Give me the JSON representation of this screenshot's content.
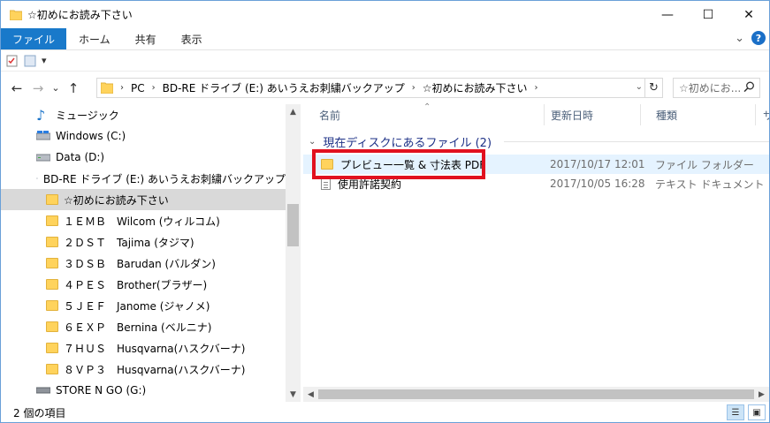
{
  "window": {
    "title": "☆初めにお読み下さい",
    "minimize": "—",
    "maximize": "☐",
    "close": "✕"
  },
  "ribbon": {
    "tabs": [
      "ファイル",
      "ホーム",
      "共有",
      "表示"
    ],
    "expand": "⌄",
    "help": "?"
  },
  "quick_access": {
    "dropdown": "▾"
  },
  "address": {
    "back": "←",
    "forward": "→",
    "recent": "⌄",
    "up": "↑",
    "segments": [
      "PC",
      "BD-RE ドライブ (E:) あいうえお刺繍バックアップ",
      "☆初めにお読み下さい"
    ],
    "separator": "›",
    "dropdown": "⌄",
    "refresh": "↻"
  },
  "search": {
    "placeholder": "☆初めにお...",
    "icon": "search-icon"
  },
  "nav_pane": {
    "items": [
      {
        "label": "ミュージック",
        "icon": "music-note-icon"
      },
      {
        "label": "Windows (C:)",
        "icon": "drive-icon"
      },
      {
        "label": "Data (D:)",
        "icon": "drive-icon"
      },
      {
        "label": "BD-RE ドライブ (E:) あいうえお刺繍バックアップ",
        "icon": "disc-icon"
      },
      {
        "label": "☆初めにお読み下さい",
        "icon": "folder-icon",
        "selected": true
      },
      {
        "label": "１ＥＭＢ　Wilcom (ウィルコム)",
        "icon": "folder-icon"
      },
      {
        "label": "２ＤＳＴ　Tajima (タジマ)",
        "icon": "folder-icon"
      },
      {
        "label": "３ＤＳＢ　Barudan (バルダン)",
        "icon": "folder-icon"
      },
      {
        "label": "４ＰＥＳ　Brother(ブラザー)",
        "icon": "folder-icon"
      },
      {
        "label": "５ＪＥＦ　Janome (ジャノメ)",
        "icon": "folder-icon"
      },
      {
        "label": "６ＥＸＰ　Bernina (ベルニナ)",
        "icon": "folder-icon"
      },
      {
        "label": "７ＨＵＳ　Husqvarna(ハスクバーナ)",
        "icon": "folder-icon"
      },
      {
        "label": "８ＶＰ３　Husqvarna(ハスクバーナ)",
        "icon": "folder-icon"
      },
      {
        "label": "STORE N GO (G:)",
        "icon": "drive-icon"
      }
    ]
  },
  "content": {
    "columns": [
      "名前",
      "更新日時",
      "種類",
      "サ"
    ],
    "group_label": "現在ディスクにあるファイル (2)",
    "files": [
      {
        "name": "プレビュー一覧 & 寸法表 PDF",
        "date": "2017/10/17 12:01",
        "type": "ファイル フォルダー",
        "icon": "folder-icon",
        "highlighted": true
      },
      {
        "name": "使用許諾契約",
        "date": "2017/10/05 16:28",
        "type": "テキスト ドキュメント",
        "icon": "text-document-icon"
      }
    ]
  },
  "status": {
    "count": "2 個の項目"
  },
  "colors": {
    "file_tab": "#1979ca",
    "selection": "#d9d9d9",
    "hover_row": "#e5f3ff",
    "highlight_box": "#e1111f",
    "group_text": "#1e3287"
  }
}
